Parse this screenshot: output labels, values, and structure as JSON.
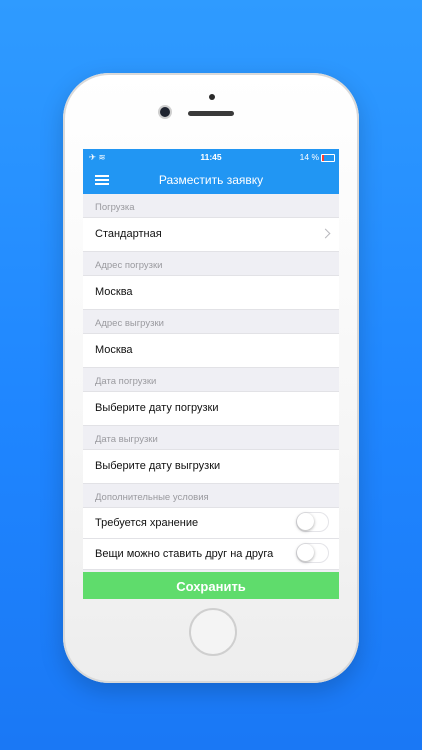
{
  "status": {
    "time": "11:45",
    "battery": "14 %"
  },
  "nav": {
    "title": "Разместить заявку"
  },
  "form": {
    "loading_type": {
      "header": "Погрузка",
      "value": "Стандартная"
    },
    "pickup_address": {
      "header": "Адрес погрузки",
      "value": "Москва"
    },
    "delivery_address": {
      "header": "Адрес выгрузки",
      "value": "Москва"
    },
    "pickup_date": {
      "header": "Дата погрузки",
      "value": "Выберите дату погрузки"
    },
    "delivery_date": {
      "header": "Дата выгрузки",
      "value": "Выберите дату выгрузки"
    },
    "extra": {
      "header": "Дополнительные условия",
      "storage": "Требуется хранение",
      "stackable": "Вещи можно ставить друг на друга"
    }
  },
  "footer": {
    "save_label": "Сохранить"
  },
  "colors": {
    "accent": "#2196f3",
    "save": "#5fdc6c",
    "background": "#1f86ff"
  }
}
